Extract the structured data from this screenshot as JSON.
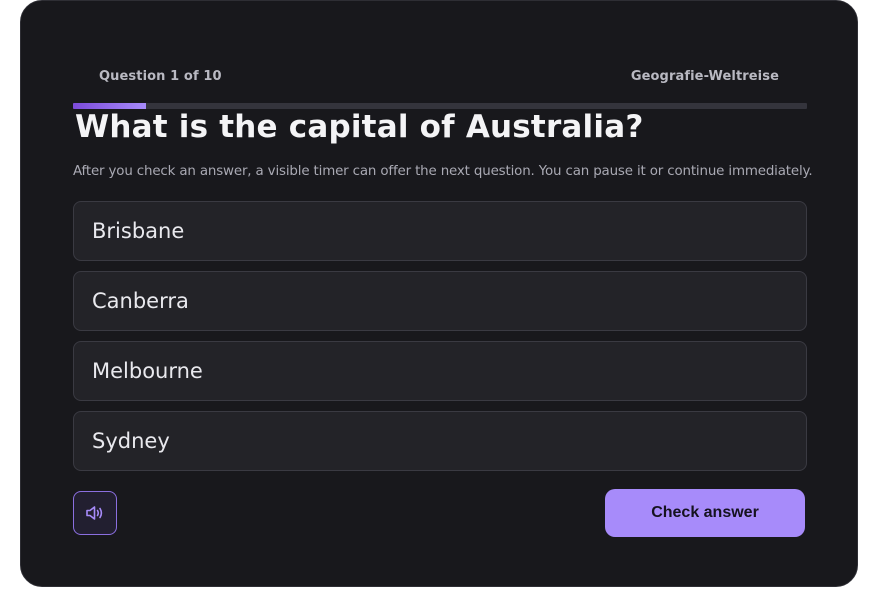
{
  "quiz": {
    "progress_label": "Question 1 of 10",
    "category": "Geografie-Weltreise",
    "progress_fraction": 0.1,
    "question": "What is the capital of Australia?",
    "hint": "After you check an answer, a visible timer can offer the next question. You can pause it or continue immediately.",
    "options": [
      "Brisbane",
      "Canberra",
      "Melbourne",
      "Sydney"
    ]
  },
  "controls": {
    "sound_icon": "speaker-icon",
    "check_label": "Check answer"
  },
  "colors": {
    "accent": "#a78bfa",
    "background": "#18181c"
  }
}
